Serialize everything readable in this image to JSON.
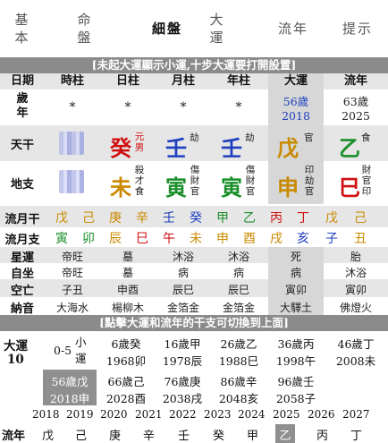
{
  "tabs": [
    {
      "label": "基\n本"
    },
    {
      "label": "命\n盤"
    },
    {
      "label": "細盤"
    },
    {
      "label": "大\n運"
    },
    {
      "label": "流年"
    },
    {
      "label": "提示"
    }
  ],
  "banner_top": "[未起大運顯示小運,十步大運要打開設置]",
  "banner_mid": "[點擊大運和流年的干支可切換到上面]",
  "headers": [
    "日期",
    "時柱",
    "日柱",
    "月柱",
    "年柱",
    "大運",
    "流年"
  ],
  "age_row": {
    "label": "歲\n年",
    "cells": [
      "*",
      "*",
      "*",
      "*"
    ],
    "dayun_age": "56歲",
    "dayun_year": "2018",
    "liunian_age": "63歲",
    "liunian_year": "2025"
  },
  "tiangan": {
    "label": "天干",
    "day": {
      "char": "癸",
      "sub": "元\n男"
    },
    "month": {
      "char": "壬",
      "sub": "劫"
    },
    "year": {
      "char": "壬",
      "sub": "劫"
    },
    "dayun": {
      "char": "戊",
      "sub": "官"
    },
    "liunian": {
      "char": "乙",
      "sub": "食"
    }
  },
  "dizhi": {
    "label": "地支",
    "day": {
      "char": "未",
      "sub": "殺\n才\n食"
    },
    "month": {
      "char": "寅",
      "sub": "傷\n財\n官"
    },
    "year": {
      "char": "寅",
      "sub": "傷\n財\n官"
    },
    "dayun": {
      "char": "申",
      "sub": "印\n劫\n官"
    },
    "liunian": {
      "char": "巳",
      "sub": "財\n官\n印"
    }
  },
  "liuyue_gan": {
    "label": "流月干",
    "chars": [
      "戊",
      "己",
      "庚",
      "辛",
      "壬",
      "癸",
      "甲",
      "乙",
      "丙",
      "丁",
      "戊",
      "己"
    ]
  },
  "liuyue_zhi": {
    "label": "流月支",
    "chars": [
      "寅",
      "卯",
      "辰",
      "巳",
      "午",
      "未",
      "申",
      "酉",
      "戌",
      "亥",
      "子",
      "丑"
    ]
  },
  "info_rows": [
    {
      "label": "星運",
      "cells": [
        "帝旺",
        "墓",
        "沐浴",
        "沐浴",
        "死",
        "胎"
      ]
    },
    {
      "label": "自坐",
      "cells": [
        "帝旺",
        "墓",
        "病",
        "病",
        "病",
        "沐浴"
      ]
    },
    {
      "label": "空亡",
      "cells": [
        "子丑",
        "申酉",
        "辰巳",
        "辰巳",
        "寅卯",
        "寅卯"
      ]
    },
    {
      "label": "納音",
      "cells": [
        "大海水",
        "楊柳木",
        "金箔金",
        "金箔金",
        "大驛土",
        "佛燈火"
      ]
    }
  ],
  "dayun": {
    "label": "大運",
    "start": "10",
    "xiaoyun_age": "0-5",
    "xiaoyun_label": "小\n運",
    "entries": [
      {
        "age": "6歲",
        "gan": "癸",
        "year": "1968",
        "zhi": "卯"
      },
      {
        "age": "16歲",
        "gan": "甲",
        "year": "1978",
        "zhi": "辰"
      },
      {
        "age": "26歲",
        "gan": "乙",
        "year": "1988",
        "zhi": "巳"
      },
      {
        "age": "36歲",
        "gan": "丙",
        "year": "1998",
        "zhi": "午"
      },
      {
        "age": "46歲",
        "gan": "丁",
        "year": "2008",
        "zhi": "未"
      },
      {
        "age": "56歲",
        "gan": "戊",
        "year": "2018",
        "zhi": "申"
      },
      {
        "age": "66歲",
        "gan": "己",
        "year": "2028",
        "zhi": "酉"
      },
      {
        "age": "76歲",
        "gan": "庚",
        "year": "2038",
        "zhi": "戌"
      },
      {
        "age": "86歲",
        "gan": "辛",
        "year": "2048",
        "zhi": "亥"
      },
      {
        "age": "96歲",
        "gan": "壬",
        "year": "2058",
        "zhi": "子"
      }
    ]
  },
  "years": [
    "2018",
    "2019",
    "2020",
    "2021",
    "2022",
    "2023",
    "2024",
    "2025",
    "2026",
    "2027"
  ],
  "liunian_row": {
    "label": "流年",
    "chars": [
      "戊",
      "己",
      "庚",
      "辛",
      "壬",
      "癸",
      "甲",
      "乙",
      "丙",
      "丁"
    ]
  },
  "colors": {
    "earth": "#c98a00",
    "metal": "#c98a00",
    "water": "#1f3fbf",
    "wood": "#1a8f2a",
    "fire": "#d01010",
    "red": "#d01010",
    "green": "#1a8f2a",
    "blue": "#1f3fbf",
    "banner": "#8b8b8b",
    "selected": "#d7d7d7"
  }
}
